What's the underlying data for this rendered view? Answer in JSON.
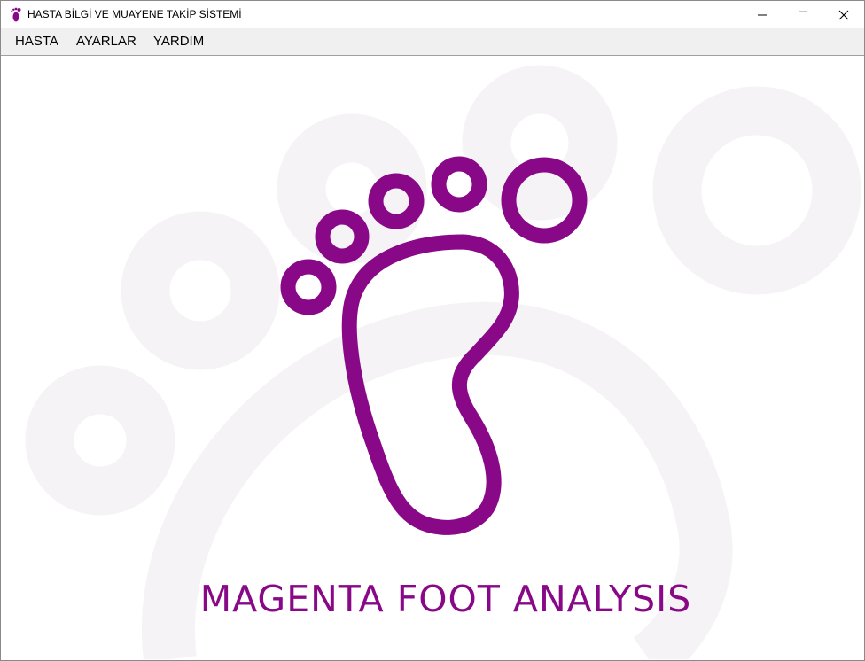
{
  "window": {
    "title": "HASTA BİLGİ VE MUAYENE TAKİP SİSTEMİ",
    "app_icon": "footprint-icon",
    "controls": {
      "minimize_icon": "minimize-icon",
      "maximize_icon": "maximize-icon",
      "close_icon": "close-icon"
    }
  },
  "menu": {
    "items": [
      {
        "label": "HASTA"
      },
      {
        "label": "AYARLAR"
      },
      {
        "label": "YARDIM"
      }
    ]
  },
  "splash": {
    "logo_icon": "foot-logo-icon",
    "brand_name": "MAGENTA FOOT ANALYSIS",
    "brand_color": "#880888",
    "background_tint": "#f6f3f6"
  }
}
